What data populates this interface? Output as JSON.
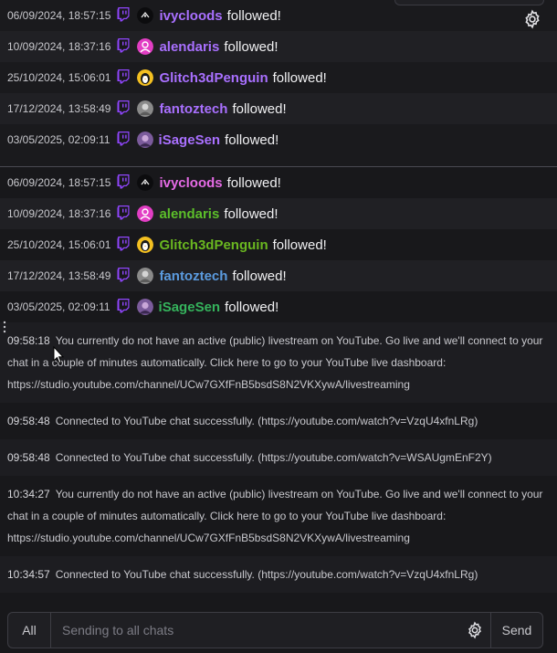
{
  "follow_text": "followed!",
  "top_events": [
    {
      "time": "06/09/2024, 18:57:15",
      "user": "ivycloods",
      "color": "#a970ff"
    },
    {
      "time": "10/09/2024, 18:37:16",
      "user": "alendaris",
      "color": "#a970ff"
    },
    {
      "time": "25/10/2024, 15:06:01",
      "user": "Glitch3dPenguin",
      "color": "#a970ff"
    },
    {
      "time": "17/12/2024, 13:58:49",
      "user": "fantoztech",
      "color": "#a970ff"
    },
    {
      "time": "03/05/2025, 02:09:11",
      "user": "iSageSen",
      "color": "#a970ff"
    }
  ],
  "bottom_events": [
    {
      "time": "06/09/2024, 18:57:15",
      "user": "ivycloods",
      "color": "#e56be5"
    },
    {
      "time": "10/09/2024, 18:37:16",
      "user": "alendaris",
      "color": "#5cbf2a"
    },
    {
      "time": "25/10/2024, 15:06:01",
      "user": "Glitch3dPenguin",
      "color": "#6ab820"
    },
    {
      "time": "17/12/2024, 13:58:49",
      "user": "fantoztech",
      "color": "#5b9bdf"
    },
    {
      "time": "03/05/2025, 02:09:11",
      "user": "iSageSen",
      "color": "#35b35c"
    }
  ],
  "youtube_messages": [
    {
      "time": "09:58:18",
      "text": "You currently do not have an active (public) livestream on YouTube. Go live and we'll connect to your chat in a couple of minutes automatically. Click here to go to your YouTube live dashboard: https://studio.youtube.com/channel/UCw7GXfFnB5bsdS8N2VKXywA/livestreaming"
    },
    {
      "time": "09:58:48",
      "text": "Connected to YouTube chat successfully. (https://youtube.com/watch?v=VzqU4xfnLRg)"
    },
    {
      "time": "09:58:48",
      "text": "Connected to YouTube chat successfully. (https://youtube.com/watch?v=WSAUgmEnF2Y)"
    },
    {
      "time": "10:34:27",
      "text": "You currently do not have an active (public) livestream on YouTube. Go live and we'll connect to your chat in a couple of minutes automatically. Click here to go to your YouTube live dashboard: https://studio.youtube.com/channel/UCw7GXfFnB5bsdS8N2VKXywA/livestreaming"
    },
    {
      "time": "10:34:57",
      "text": "Connected to YouTube chat successfully. (https://youtube.com/watch?v=VzqU4xfnLRg)"
    },
    {
      "time": "10:34:57",
      "text": "Connected to YouTube chat successfully. (https://youtube.com/watch?v=WSAUgmEnF2Y)"
    }
  ],
  "composer": {
    "all_label": "All",
    "placeholder": "Sending to all chats",
    "send_label": "Send"
  },
  "colors": {
    "twitch_brand": "#9146ff",
    "background": "#18181b"
  },
  "icons": {
    "platform": "twitch-icon",
    "settings": "gear-icon"
  }
}
